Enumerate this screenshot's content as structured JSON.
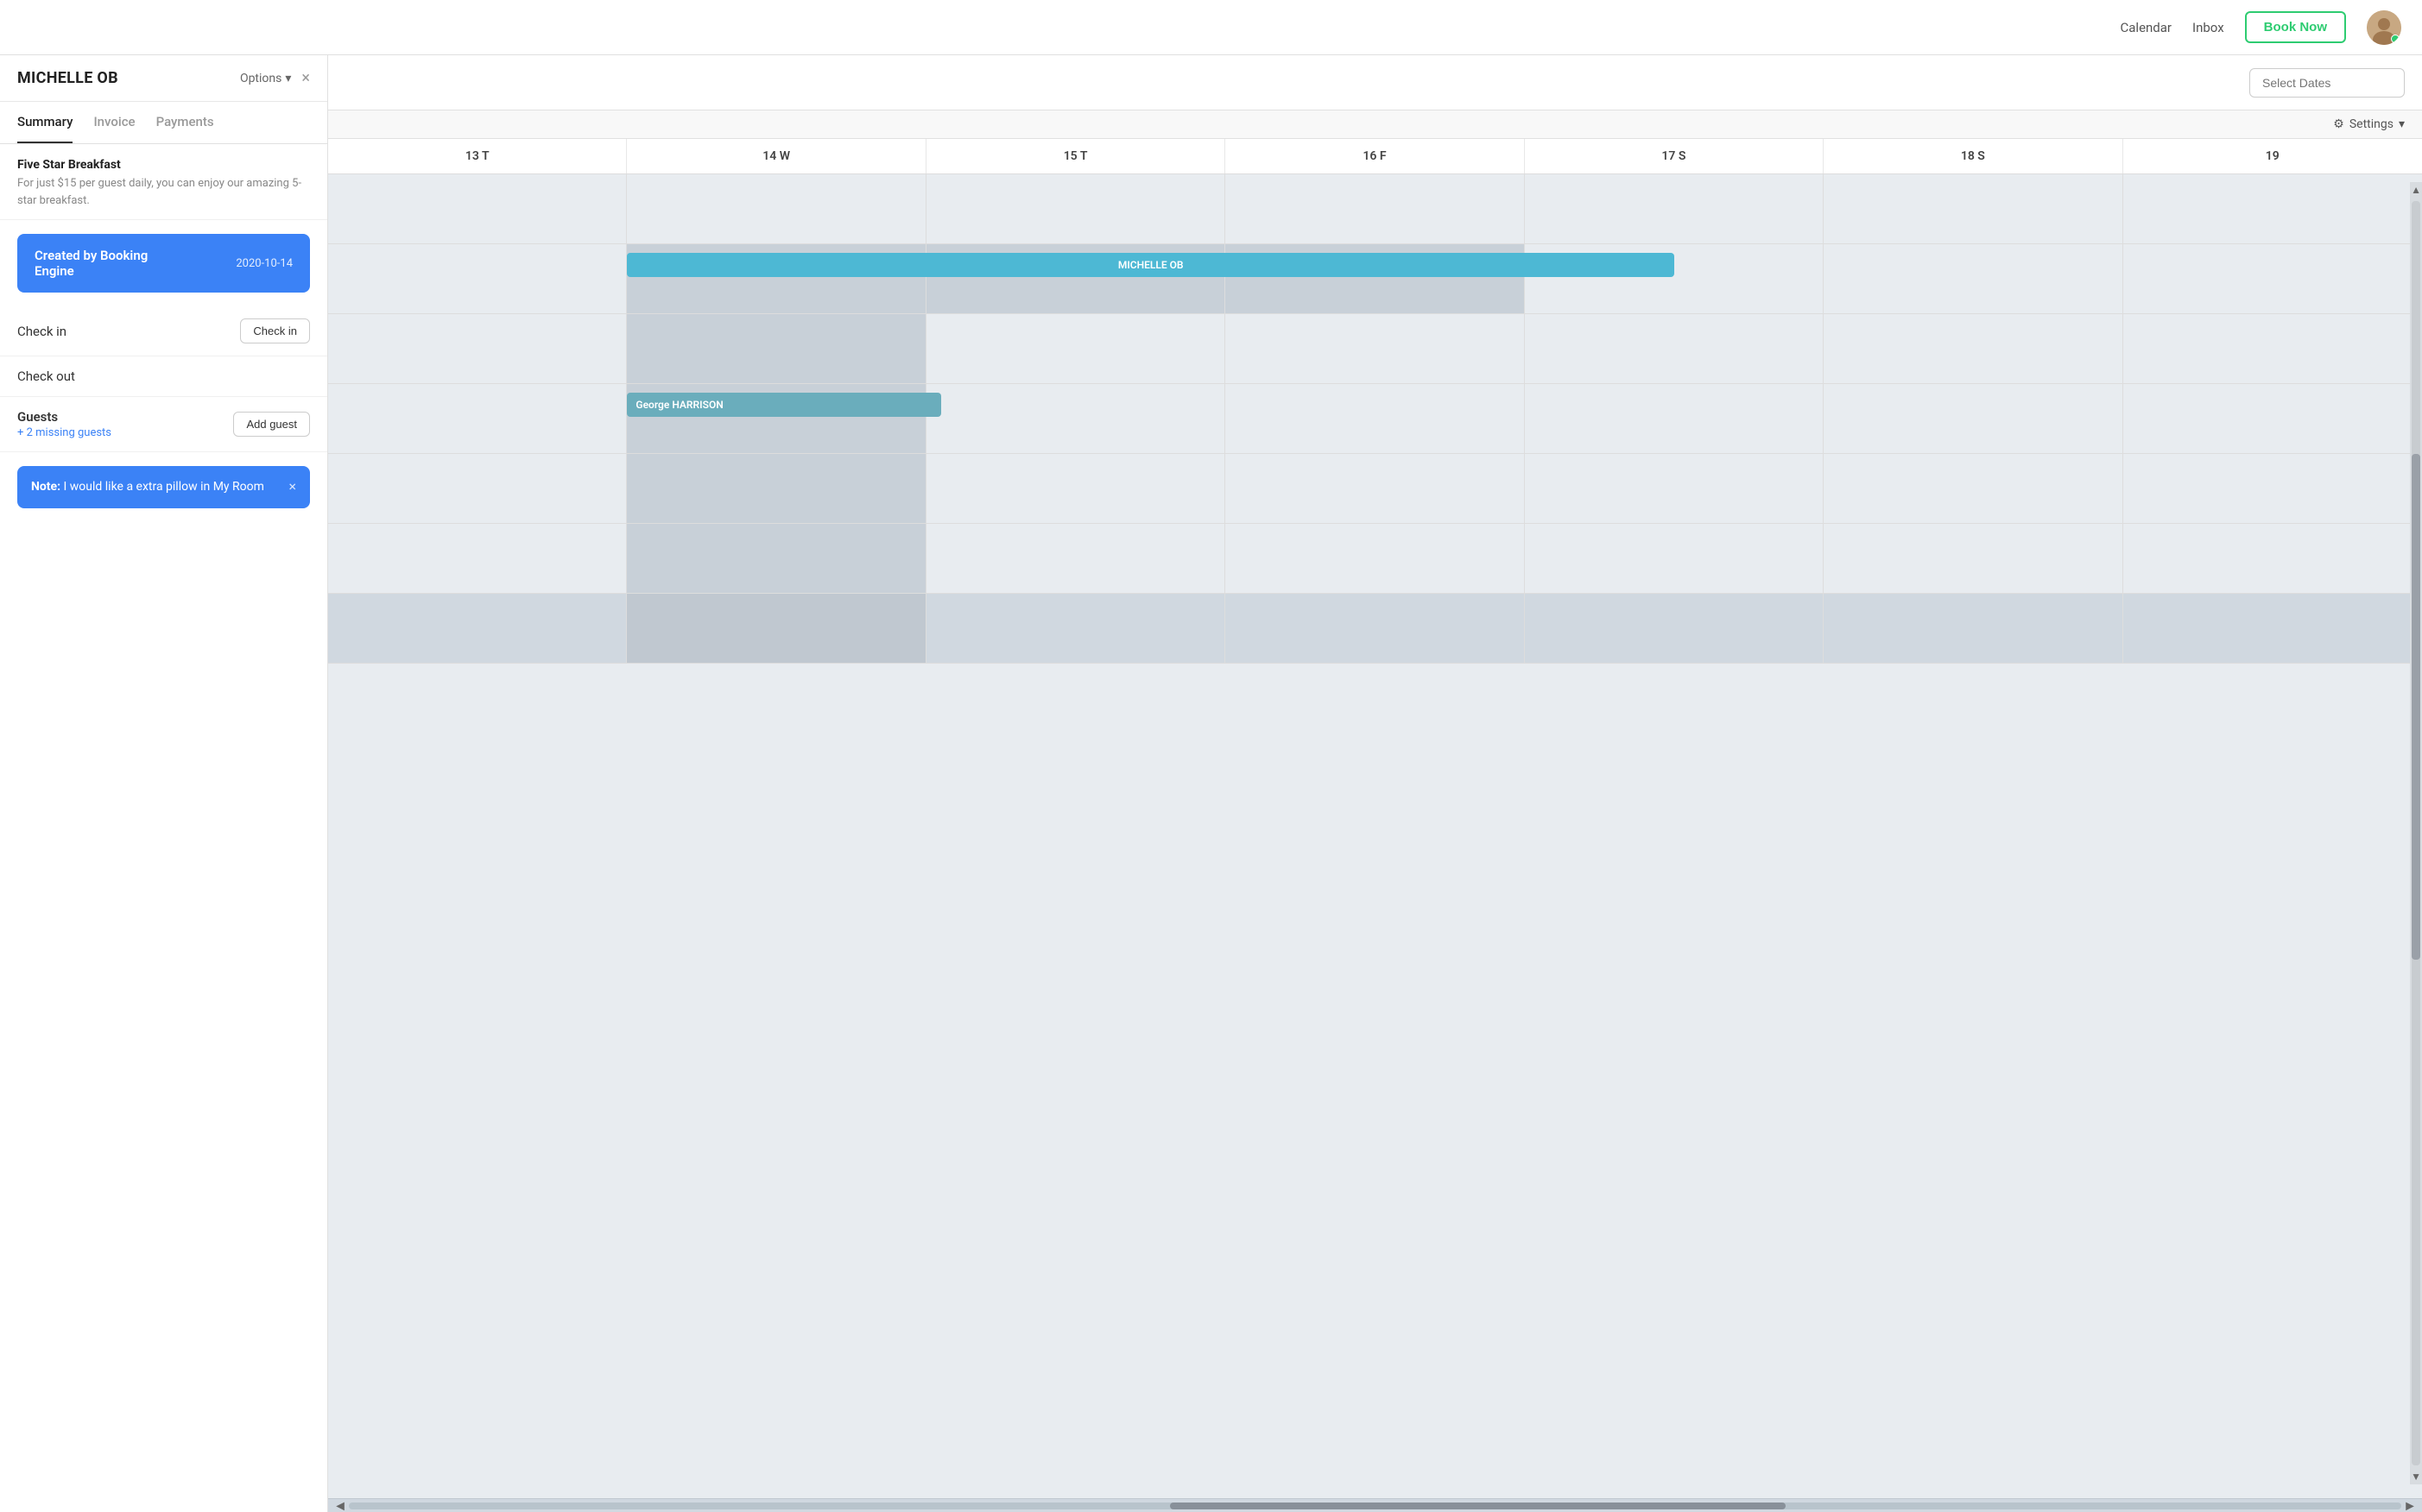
{
  "topNav": {
    "calendarLabel": "Calendar",
    "inboxLabel": "Inbox",
    "bookNowLabel": "Book Now"
  },
  "leftPanel": {
    "title": "MICHELLE OB",
    "optionsLabel": "Options",
    "closeIcon": "×",
    "tabs": [
      {
        "label": "Summary",
        "active": true
      },
      {
        "label": "Invoice",
        "active": false
      },
      {
        "label": "Payments",
        "active": false
      }
    ],
    "breakfast": {
      "title": "Five Star Breakfast",
      "description": "For just $15 per guest daily, you can enjoy our amazing 5-star breakfast."
    },
    "bookingCard": {
      "line1": "Created by Booking",
      "line2": "Engine",
      "date": "2020-10-14"
    },
    "checkIn": {
      "label": "Check in",
      "buttonLabel": "Check in"
    },
    "checkOut": {
      "label": "Check out"
    },
    "guests": {
      "title": "Guests",
      "missing": "+ 2 missing guests",
      "addButtonLabel": "Add guest"
    },
    "note": {
      "prefix": "Note:",
      "text": " I would like a extra pillow in My Room",
      "closeIcon": "×"
    }
  },
  "calendar": {
    "selectDatesPlaceholder": "Select Dates",
    "settingsLabel": "Settings",
    "columns": [
      {
        "day": "13",
        "weekday": "T"
      },
      {
        "day": "14",
        "weekday": "W"
      },
      {
        "day": "15",
        "weekday": "T"
      },
      {
        "day": "16",
        "weekday": "F"
      },
      {
        "day": "17",
        "weekday": "S"
      },
      {
        "day": "18",
        "weekday": "S"
      },
      {
        "day": "19",
        "weekday": ""
      }
    ],
    "bookings": [
      {
        "name": "MICHELLE OB",
        "type": "michelle"
      },
      {
        "name": "George HARRISON",
        "type": "george"
      }
    ]
  }
}
